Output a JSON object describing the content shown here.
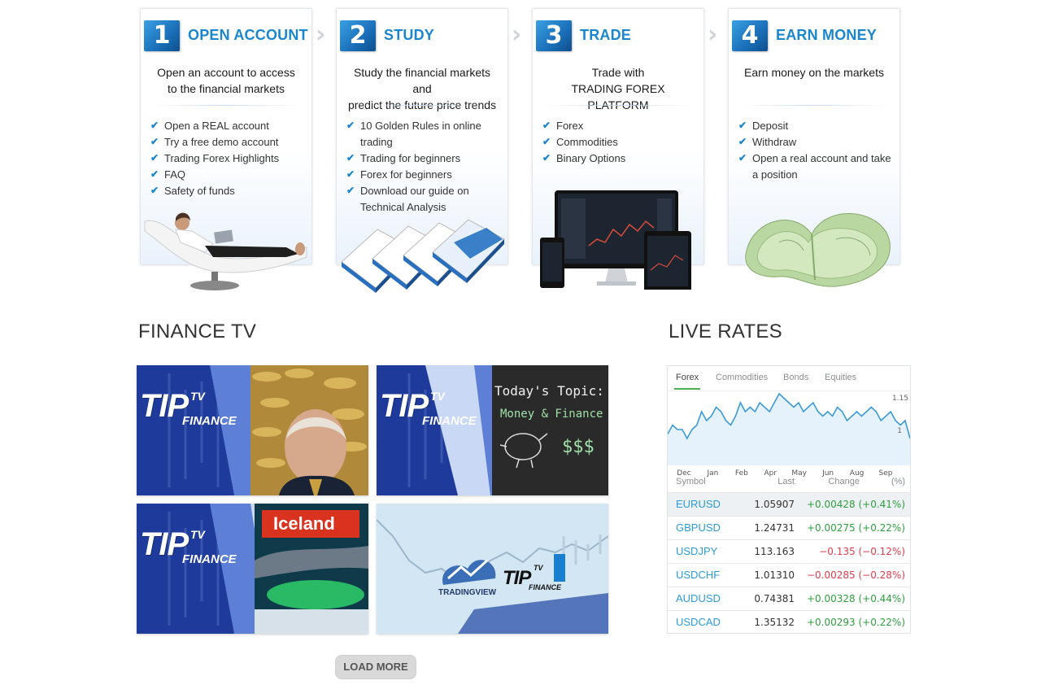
{
  "steps": [
    {
      "num": "1",
      "title": "OPEN ACCOUNT",
      "desc": [
        "Open an account to access",
        "to the financial markets"
      ],
      "items": [
        "Open a REAL account",
        "Try a free demo account",
        "Trading Forex Highlights",
        "FAQ",
        "Safety of funds"
      ]
    },
    {
      "num": "2",
      "title": "STUDY",
      "desc": [
        "Study the financial markets and",
        "predict the future price trends"
      ],
      "items": [
        "10 Golden Rules in online trading",
        "Trading for beginners",
        "Forex for beginners",
        "Download our guide on Technical Analysis"
      ]
    },
    {
      "num": "3",
      "title": "TRADE",
      "desc": [
        "Trade with",
        "TRADING FOREX PLATFORM"
      ],
      "items": [
        "Forex",
        "Commodities",
        "Binary Options"
      ]
    },
    {
      "num": "4",
      "title": "EARN MONEY",
      "desc": [
        "Earn money on the markets",
        ""
      ],
      "items": [
        "Deposit",
        "Withdraw",
        "Open a real account and take a position"
      ]
    }
  ],
  "finance_tv": {
    "title": "FINANCE TV",
    "logo_big": "TIP",
    "logo_tv": "TV",
    "logo_finance": "FINANCE",
    "tile2_topic": "Today's Topic:",
    "tile2_subject": "Money & Finance",
    "tile2_dollars": "$$$",
    "tile3_brand": "Iceland",
    "tile4_brand": "TRADINGVIEW",
    "load_more": "LOAD MORE"
  },
  "live_rates": {
    "title": "LIVE RATES",
    "tabs": [
      "Forex",
      "Commodities",
      "Bonds",
      "Equities"
    ],
    "active_tab": "Forex",
    "chart_months": [
      "Dec",
      "Jan",
      "Feb",
      "Apr",
      "May",
      "Jun",
      "Aug",
      "Sep"
    ],
    "chart_ticks": [
      "1.15",
      "1"
    ],
    "headers": {
      "symbol": "Symbol",
      "last": "Last",
      "change": "Change",
      "pct": "(%)"
    },
    "rows": [
      {
        "symbol": "EURUSD",
        "last": "1.05907",
        "change": "+0.00428 (+0.41%)",
        "dir": "pos"
      },
      {
        "symbol": "GBPUSD",
        "last": "1.24731",
        "change": "+0.00275 (+0.22%)",
        "dir": "pos"
      },
      {
        "symbol": "USDJPY",
        "last": "113.163",
        "change": "−0.135 (−0.12%)",
        "dir": "neg"
      },
      {
        "symbol": "USDCHF",
        "last": "1.01310",
        "change": "−0.00285 (−0.28%)",
        "dir": "neg"
      },
      {
        "symbol": "AUDUSD",
        "last": "0.74381",
        "change": "+0.00328 (+0.44%)",
        "dir": "pos"
      },
      {
        "symbol": "USDCAD",
        "last": "1.35132",
        "change": "+0.00293 (+0.22%)",
        "dir": "pos"
      }
    ]
  },
  "chart_data": {
    "type": "line",
    "series": [
      {
        "values": [
          1.07,
          1.09,
          1.08,
          1.08,
          1.06,
          1.08,
          1.09,
          1.12,
          1.1,
          1.11,
          1.13,
          1.12,
          1.1,
          1.09,
          1.11,
          1.14,
          1.12,
          1.13,
          1.12,
          1.14,
          1.13,
          1.12,
          1.14,
          1.16,
          1.15,
          1.14,
          1.13,
          1.14,
          1.12,
          1.13,
          1.14,
          1.12,
          1.11,
          1.12,
          1.11,
          1.13,
          1.12,
          1.1,
          1.11,
          1.12,
          1.11,
          1.12,
          1.13,
          1.12,
          1.1,
          1.11,
          1.12,
          1.1,
          1.09,
          1.1,
          1.06
        ]
      }
    ],
    "ylim": [
      1.0,
      1.16
    ],
    "tick_labels": [
      "1.15",
      "1"
    ],
    "x_labels": [
      "Dec",
      "Jan",
      "Feb",
      "Apr",
      "May",
      "Jun",
      "Aug",
      "Sep"
    ],
    "grid": false
  },
  "colors": {
    "accent": "#1a86cf",
    "positive": "#2e9e3e",
    "negative": "#e03c4c",
    "symbol": "#2a9cd8"
  }
}
